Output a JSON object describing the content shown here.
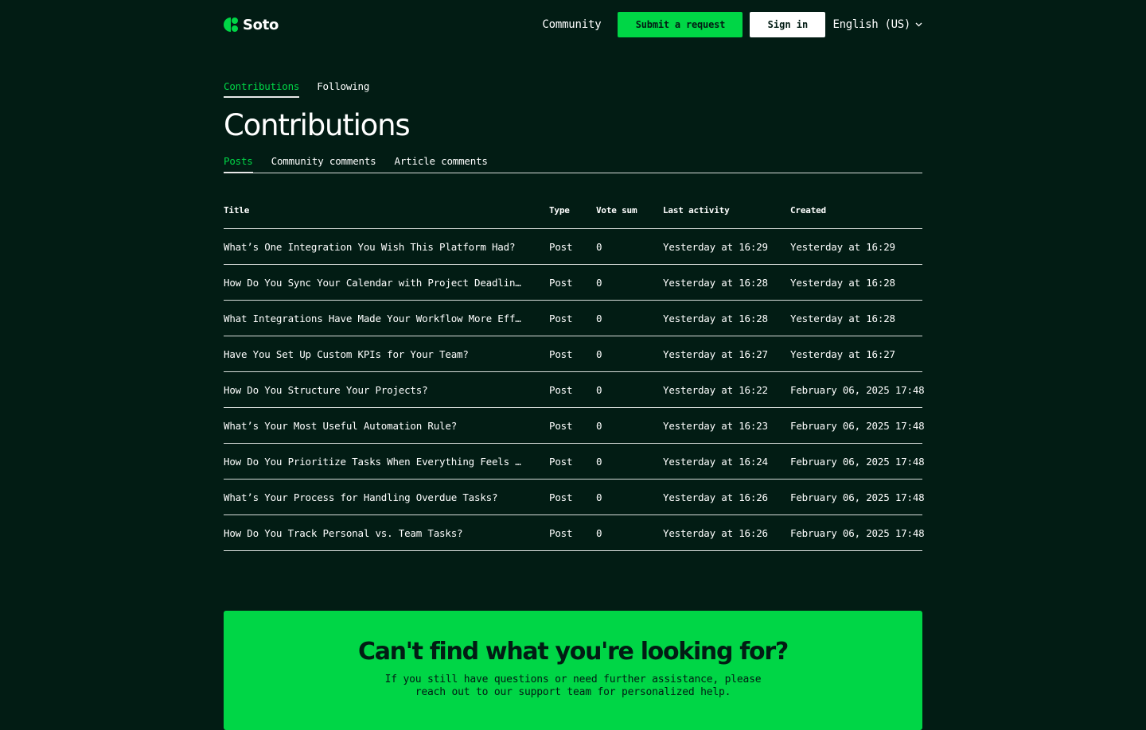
{
  "header": {
    "logo_text": "Soto",
    "community_label": "Community",
    "submit_label": "Submit a request",
    "signin_label": "Sign in",
    "language_label": "English (US)"
  },
  "profile_tabs": [
    {
      "label": "Contributions",
      "active": true
    },
    {
      "label": "Following",
      "active": false
    }
  ],
  "page_title": "Contributions",
  "sub_tabs": [
    {
      "label": "Posts",
      "active": true
    },
    {
      "label": "Community comments",
      "active": false
    },
    {
      "label": "Article comments",
      "active": false
    }
  ],
  "table": {
    "columns": [
      "Title",
      "Type",
      "Vote sum",
      "Last activity",
      "Created"
    ],
    "rows": [
      {
        "title": "What’s One Integration You Wish This Platform Had?",
        "type": "Post",
        "vote_sum": "0",
        "last_activity": "Yesterday at 16:29",
        "created": "Yesterday at 16:29"
      },
      {
        "title": "How Do You Sync Your Calendar with Project Deadline…",
        "type": "Post",
        "vote_sum": "0",
        "last_activity": "Yesterday at 16:28",
        "created": "Yesterday at 16:28"
      },
      {
        "title": "What Integrations Have Made Your Workflow More Effi…",
        "type": "Post",
        "vote_sum": "0",
        "last_activity": "Yesterday at 16:28",
        "created": "Yesterday at 16:28"
      },
      {
        "title": "Have You Set Up Custom KPIs for Your Team?",
        "type": "Post",
        "vote_sum": "0",
        "last_activity": "Yesterday at 16:27",
        "created": "Yesterday at 16:27"
      },
      {
        "title": "How Do You Structure Your Projects?",
        "type": "Post",
        "vote_sum": "0",
        "last_activity": "Yesterday at 16:22",
        "created": "February 06, 2025 17:48"
      },
      {
        "title": "What’s Your Most Useful Automation Rule?",
        "type": "Post",
        "vote_sum": "0",
        "last_activity": "Yesterday at 16:23",
        "created": "February 06, 2025 17:48"
      },
      {
        "title": "How Do You Prioritize Tasks When Everything Feels U…",
        "type": "Post",
        "vote_sum": "0",
        "last_activity": "Yesterday at 16:24",
        "created": "February 06, 2025 17:48"
      },
      {
        "title": "What’s Your Process for Handling Overdue Tasks?",
        "type": "Post",
        "vote_sum": "0",
        "last_activity": "Yesterday at 16:26",
        "created": "February 06, 2025 17:48"
      },
      {
        "title": "How Do You Track Personal vs. Team Tasks?",
        "type": "Post",
        "vote_sum": "0",
        "last_activity": "Yesterday at 16:26",
        "created": "February 06, 2025 17:48"
      }
    ]
  },
  "cta": {
    "title": "Can't find what you're looking for?",
    "text": "If you still have questions or need further assistance, please reach out to our support team for personalized help."
  },
  "icons": {
    "logo": "soto-logo-icon",
    "language_dropdown": "chevron-down-icon"
  },
  "colors": {
    "background": "#021c14",
    "accent": "#00d646",
    "text": "#ffffff"
  }
}
